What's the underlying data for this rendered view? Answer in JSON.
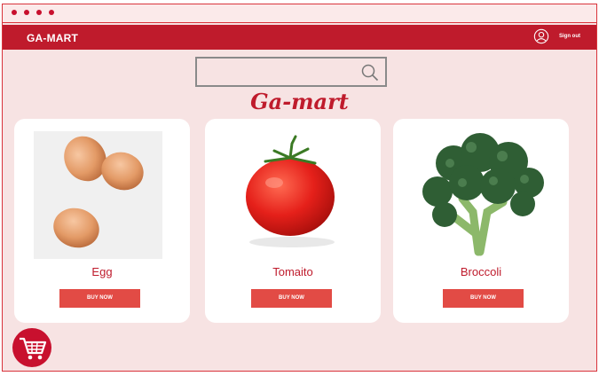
{
  "app": {
    "brand": "GA-MART",
    "logo_text": "Ga-mart"
  },
  "header": {
    "signout_label": "Sign out",
    "user_icon": "user-circle-icon"
  },
  "search": {
    "value": "",
    "placeholder": "",
    "icon": "search-icon"
  },
  "products": [
    {
      "name": "Egg",
      "button_label": "BUY NOW",
      "image": "eggs-photo"
    },
    {
      "name": "Tomaito",
      "button_label": "BUY NOW",
      "image": "tomato-photo"
    },
    {
      "name": "Broccoli",
      "button_label": "BUY NOW",
      "image": "broccoli-photo"
    }
  ],
  "cart": {
    "icon": "shopping-cart-icon"
  },
  "colors": {
    "accent": "#bf1b2c",
    "button": "#e24b45",
    "background": "#f7e3e3"
  }
}
